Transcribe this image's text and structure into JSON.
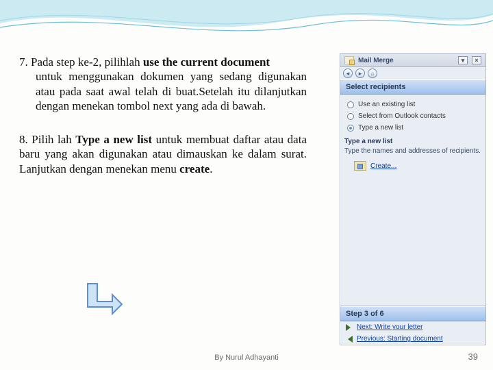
{
  "paragraphs": {
    "p7_prefix": "7. Pada step ke-2, pilihlah ",
    "p7_bold": "use the current document",
    "p7_rest": " untuk menggunakan dokumen yang sedang digunakan atau pada saat awal telah di buat.Setelah itu dilanjutkan dengan menekan tombol next yang ada di bawah.",
    "p8_prefix": "8. Pilih lah ",
    "p8_bold": "Type a new list",
    "p8_mid": " untuk membuat daftar atau data baru yang akan digunakan atau dimauskan ke dalam surat. Lanjutkan dengan menekan menu ",
    "p8_bold2": "create",
    "p8_end": "."
  },
  "footer": {
    "credit": "By Nurul Adhayanti",
    "page": "39"
  },
  "pane": {
    "title": "Mail Merge",
    "head1": "Select recipients",
    "radios": {
      "opt1": "Use an existing list",
      "opt2": "Select from Outlook contacts",
      "opt3": "Type a new list"
    },
    "sub_head": "Type a new list",
    "sub_desc": "Type the names and addresses of recipients.",
    "create": "Create...",
    "step": "Step 3 of 6",
    "next": "Next: Write your letter",
    "prev": "Previous: Starting document"
  }
}
